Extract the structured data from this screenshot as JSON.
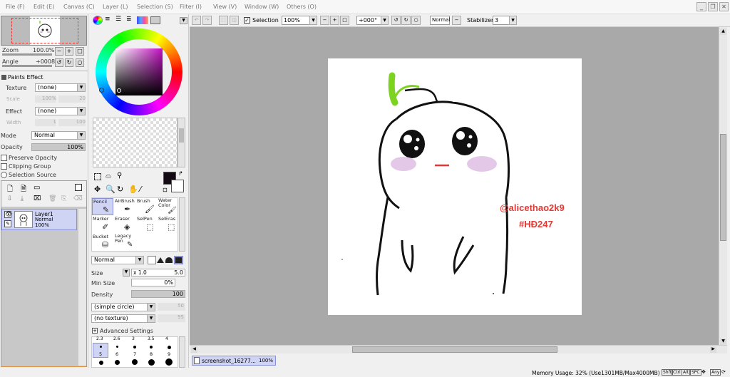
{
  "menu": [
    "File (F)",
    "Edit (E)",
    "Canvas (C)",
    "Layer (L)",
    "Selection (S)",
    "Filter (I)",
    "View (V)",
    "Window (W)",
    "Others (O)"
  ],
  "navigator": {
    "zoom_label": "Zoom",
    "zoom_value": "100.0%",
    "angle_label": "Angle",
    "angle_value": "+0008"
  },
  "paints_effect": {
    "title": "Paints Effect",
    "texture_label": "Texture",
    "texture_value": "(none)",
    "scale_label": "Scale",
    "scale_value": "100%",
    "scale_num": "20",
    "effect_label": "Effect",
    "effect_value": "(none)",
    "width_label": "Width",
    "width_value": "1",
    "width_num": "100"
  },
  "layer_props": {
    "mode_label": "Mode",
    "mode_value": "Normal",
    "opacity_label": "Opacity",
    "opacity_value": "100%",
    "preserve_opacity": "Preserve Opacity",
    "clipping_group": "Clipping Group",
    "selection_source": "Selection Source"
  },
  "layer": {
    "name": "Layer1",
    "mode": "Normal",
    "opacity": "100%"
  },
  "tools": [
    {
      "label": "Pencil"
    },
    {
      "label": "AirBrush"
    },
    {
      "label": "Brush"
    },
    {
      "label": "Water Color"
    },
    {
      "label": "Marker"
    },
    {
      "label": "Eraser"
    },
    {
      "label": "SelPen"
    },
    {
      "label": "SelEras"
    },
    {
      "label": "Bucket"
    },
    {
      "label": "Legacy Pen"
    }
  ],
  "brush": {
    "blend_mode": "Normal",
    "size_label": "Size",
    "size_mult": "x 1.0",
    "size_value": "5.0",
    "min_size_label": "Min Size",
    "min_size_value": "0%",
    "density_label": "Density",
    "density_value": "100",
    "shape_value": "(simple circle)",
    "shape_num": "50",
    "texture_value": "(no texture)",
    "texture_num": "95",
    "advanced_label": "Advanced Settings",
    "size_presets_top": [
      "2.3",
      "2.6",
      "3",
      "3.5",
      "4"
    ],
    "size_presets": [
      "5",
      "6",
      "7",
      "8",
      "9"
    ]
  },
  "toolbar": {
    "selection_label": "Selection",
    "zoom_value": "100%",
    "angle_value": "+000°",
    "blend_value": "Normal",
    "stabilizer_label": "Stabilizer",
    "stabilizer_value": "3"
  },
  "canvas": {
    "text_line1": "@alicethao2k9",
    "text_line2": "#HĐ247"
  },
  "doc_tab": {
    "name": "screenshot_16277...",
    "zoom": "100%"
  },
  "status": {
    "memory": "Memory Usage: 32% (Use1301MB/Max4000MB)",
    "keys": [
      "Shft",
      "Ctrl",
      "Alt",
      "SPC",
      "Any"
    ]
  },
  "colors": {
    "accent_blue": "#8890d8",
    "canvas_bg": "#a9a9a9",
    "text_red": "#e53935",
    "sprout_green": "#7ed321",
    "current_color": "#140a14"
  }
}
